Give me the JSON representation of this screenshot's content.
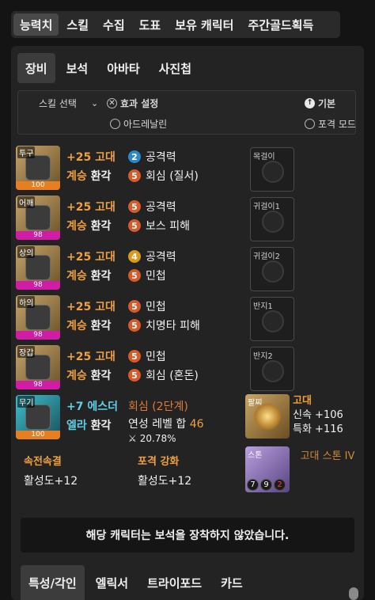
{
  "top_tabs": [
    "능력치",
    "스킬",
    "수집",
    "도표",
    "보유 캐릭터",
    "주간골드획득"
  ],
  "sub_tabs": [
    "장비",
    "보석",
    "아바타",
    "사진첩"
  ],
  "filter": {
    "skill_select": "스킬 선택",
    "effect_setting": "효과 설정",
    "basic": "기본",
    "adrenaline": "아드레날린",
    "crit_mode": "포격 모드"
  },
  "equipment": [
    {
      "slot": "투구",
      "quality": "100",
      "enh": "+25 고대",
      "tier1": "계승",
      "tier2": "환각",
      "opt1": {
        "level": "2",
        "name": "공격력"
      },
      "opt2": {
        "level": "5",
        "name": "회심 (질서)"
      }
    },
    {
      "slot": "어깨",
      "quality": "98",
      "enh": "+25 고대",
      "tier1": "계승",
      "tier2": "환각",
      "opt1": {
        "level": "5",
        "name": "공격력"
      },
      "opt2": {
        "level": "5",
        "name": "보스 피해"
      }
    },
    {
      "slot": "상의",
      "quality": "98",
      "enh": "+25 고대",
      "tier1": "계승",
      "tier2": "환각",
      "opt1": {
        "level": "4",
        "name": "공격력"
      },
      "opt2": {
        "level": "5",
        "name": "민첩"
      }
    },
    {
      "slot": "하의",
      "quality": "98",
      "enh": "+25 고대",
      "tier1": "계승",
      "tier2": "환각",
      "opt1": {
        "level": "5",
        "name": "민첩"
      },
      "opt2": {
        "level": "5",
        "name": "치명타 피해"
      }
    },
    {
      "slot": "장갑",
      "quality": "98",
      "enh": "+25 고대",
      "tier1": "계승",
      "tier2": "환각",
      "opt1": {
        "level": "5",
        "name": "민첩"
      },
      "opt2": {
        "level": "5",
        "name": "회심 (혼돈)"
      }
    }
  ],
  "weapon": {
    "slot": "무기",
    "quality": "100",
    "enh": "+7 에스더",
    "tier1": "엘라",
    "tier2": "환각",
    "opt1": "회심 (2단계)",
    "opt2_label": "연성 레벨 합",
    "opt2_value": "46",
    "opt3": "20.78%"
  },
  "accessories": [
    "목걸이",
    "귀걸이1",
    "귀걸이2",
    "반지1",
    "반지2"
  ],
  "bracelet": {
    "slot": "팔찌",
    "rank": "고대",
    "stat1": "신속 +106",
    "stat2": "특화 +116"
  },
  "engravings": [
    {
      "title": "속전속결",
      "value": "활성도+12"
    },
    {
      "title": "포격 강화",
      "value": "활성도+12"
    }
  ],
  "stone": {
    "slot": "스톤",
    "nums": [
      "7",
      "9",
      "2"
    ],
    "label": "고대 스톤 IV"
  },
  "notice": "해당 캐릭터는 보석을 장착하지 않았습니다.",
  "bottom_tabs": [
    "특성/각인",
    "엘릭서",
    "트라이포드",
    "카드"
  ]
}
